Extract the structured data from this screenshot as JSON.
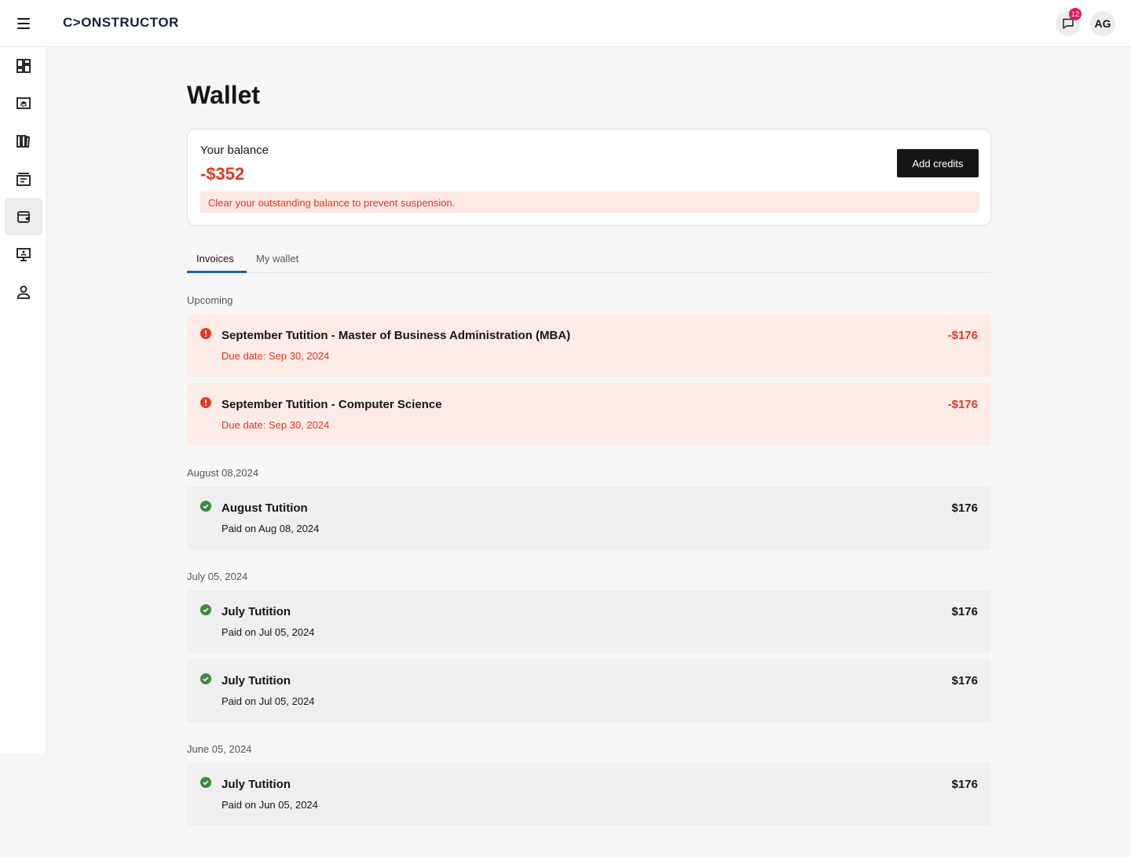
{
  "header": {
    "logo": "C>ONSTRUCTOR",
    "notification_count": "12",
    "avatar_initials": "AG"
  },
  "sidebar": {
    "items": [
      {
        "icon": "dashboard-icon"
      },
      {
        "icon": "courses-icon"
      },
      {
        "icon": "library-icon"
      },
      {
        "icon": "archive-icon"
      },
      {
        "icon": "wallet-icon",
        "active": true
      },
      {
        "icon": "presentation-icon"
      },
      {
        "icon": "profile-icon"
      }
    ]
  },
  "page": {
    "title": "Wallet"
  },
  "balance": {
    "label": "Your balance",
    "amount": "-$352",
    "add_button": "Add credits",
    "warning": "Clear your outstanding balance to prevent suspension."
  },
  "tabs": [
    {
      "label": "Invoices",
      "active": true
    },
    {
      "label": "My wallet",
      "active": false
    }
  ],
  "sections": [
    {
      "label": "Upcoming",
      "invoices": [
        {
          "title": "September Tutition - Master of Business Administration (MBA)",
          "sub": "Due date: Sep 30, 2024",
          "amount": "-$176",
          "status": "due"
        },
        {
          "title": "September Tutition - Computer Science",
          "sub": "Due date: Sep 30, 2024",
          "amount": "-$176",
          "status": "due"
        }
      ]
    },
    {
      "label": "August 08,2024",
      "invoices": [
        {
          "title": "August Tutition",
          "sub": "Paid on Aug 08, 2024",
          "amount": "$176",
          "status": "paid"
        }
      ]
    },
    {
      "label": "July 05, 2024",
      "invoices": [
        {
          "title": "July Tutition",
          "sub": "Paid on Jul 05, 2024",
          "amount": "$176",
          "status": "paid"
        },
        {
          "title": "July Tutition",
          "sub": "Paid on Jul 05, 2024",
          "amount": "$176",
          "status": "paid"
        }
      ]
    },
    {
      "label": "June 05, 2024",
      "invoices": [
        {
          "title": "July Tutition",
          "sub": "Paid on Jun 05, 2024",
          "amount": "$176",
          "status": "paid"
        }
      ]
    }
  ],
  "colors": {
    "error": "#d93b25",
    "success": "#3a8a3e",
    "tab_accent": "#1f5fa6"
  }
}
